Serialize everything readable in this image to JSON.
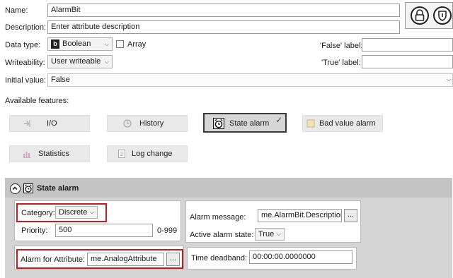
{
  "form": {
    "name_label": "Name:",
    "name_value": "AlarmBit",
    "description_label": "Description:",
    "description_value": "Enter attribute description",
    "datatype_label": "Data type:",
    "datatype_value": "Boolean",
    "array_label": "Array",
    "array_checked": false,
    "writeability_label": "Writeability:",
    "writeability_value": "User writeable",
    "initial_label": "Initial value:",
    "initial_value": "False",
    "false_label": "'False' label:",
    "false_value": "",
    "true_label": "'True' label:",
    "true_value": ""
  },
  "top_buttons": {
    "lock_icon": "padlock-icon",
    "shield_icon": "shield-icon"
  },
  "features": {
    "title": "Available features:",
    "items": [
      {
        "label": "I/O",
        "icon": "io-icon",
        "active": false
      },
      {
        "label": "History",
        "icon": "history-icon",
        "active": false
      },
      {
        "label": "State alarm",
        "icon": "alarm-clock-icon",
        "active": true
      },
      {
        "label": "Bad value alarm",
        "icon": "bad-value-icon",
        "active": false
      },
      {
        "label": "Statistics",
        "icon": "statistics-icon",
        "active": false
      },
      {
        "label": "Log change",
        "icon": "log-change-icon",
        "active": false
      }
    ],
    "checkmark": "✓"
  },
  "state_alarm": {
    "title": "State alarm",
    "collapse_icon": "chevron-up-icon",
    "category_label": "Category:",
    "category_value": "Discrete",
    "priority_label": "Priority:",
    "priority_value": "500",
    "priority_range": "0-999",
    "alarm_for_attr_label": "Alarm for Attribute:",
    "alarm_for_attr_value": "me.AnalogAttribute",
    "alarm_message_label": "Alarm message:",
    "alarm_message_value": "me.AlarmBit.Description",
    "active_state_label": "Active alarm state:",
    "active_state_value": "True",
    "time_deadband_label": "Time deadband:",
    "time_deadband_value": "00:00:00.0000000",
    "ellipsis": "..."
  },
  "colors": {
    "highlight_red": "#d0191e",
    "panel_gray": "#d4d4d4"
  }
}
